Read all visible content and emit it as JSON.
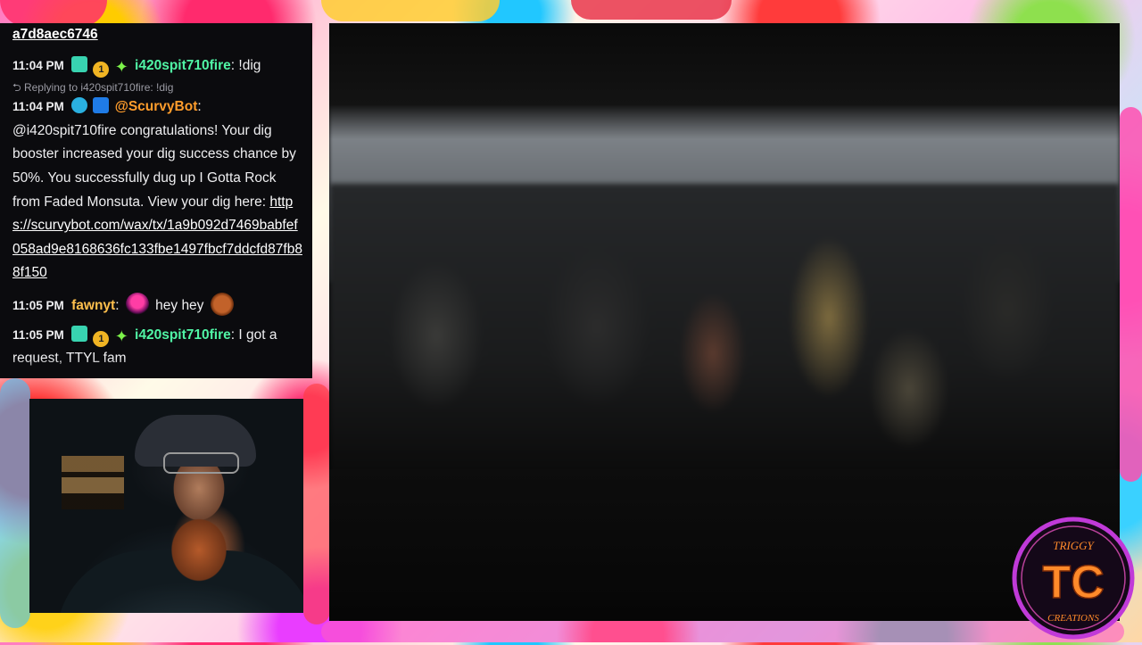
{
  "chat": {
    "partial_top": "a7d8aec6746",
    "messages": [
      {
        "time": "11:04 PM",
        "badges": [
          "sub-badge",
          "bits-badge",
          "star-badge"
        ],
        "bits_label": "1",
        "user": "i420spit710fire",
        "text": "!dig"
      },
      {
        "reply_to": "Replying to i420spit710fire: !dig",
        "time": "11:04 PM",
        "badges": [
          "bot-badge",
          "mod-badge"
        ],
        "user": "@ScurvyBot",
        "text": "@i420spit710fire congratulations! Your dig booster increased your dig success chance by 50%. You successfully dug up I Gotta Rock from Faded Monsuta. View your dig here:",
        "link": "https://scurvybot.com/wax/tx/1a9b092d7469babfef058ad9e8168636fc133fbe1497fbcf7ddcfd87fb88f150"
      },
      {
        "time": "11:05 PM",
        "user": "fawnyt",
        "text": "hey hey",
        "emotes": [
          "devil-emote",
          "bear-emote"
        ]
      },
      {
        "time": "11:05 PM",
        "badges": [
          "sub-badge",
          "bits-badge",
          "star-badge"
        ],
        "bits_label": "1",
        "user": "i420spit710fire",
        "text": "I got a request, TTYL fam"
      }
    ]
  },
  "logo": {
    "top_text": "TRIGGY",
    "initials": "TC",
    "bottom_text": "CREATIONS"
  },
  "colors": {
    "chat_bg": "#0b0b0e",
    "user_green": "#50f5a5",
    "user_orange": "#ff9d2c",
    "user_gold": "#ffc04d",
    "logo_ring": "#c03ad8",
    "logo_orange": "#ff8a2a"
  }
}
